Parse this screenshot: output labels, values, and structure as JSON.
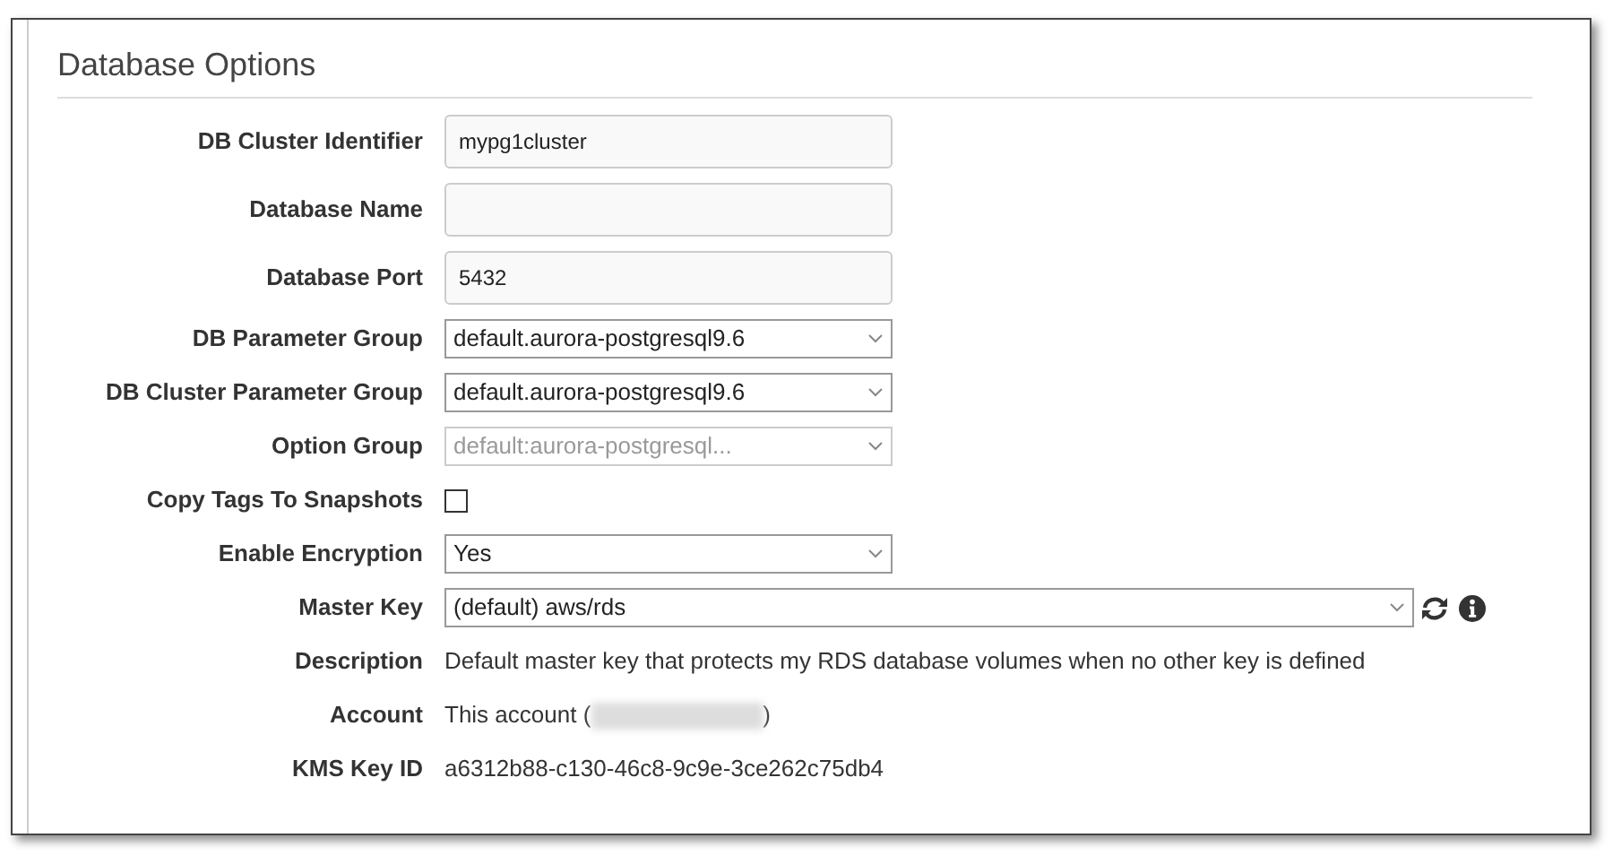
{
  "section": {
    "title": "Database Options"
  },
  "rows": [
    {
      "label": "DB Cluster Identifier",
      "kind": "text-input",
      "value": "mypg1cluster"
    },
    {
      "label": "Database Name",
      "kind": "text-input"
    },
    {
      "label": "Database Port",
      "kind": "text-input",
      "value": "5432"
    },
    {
      "label": "DB Parameter Group",
      "kind": "select",
      "value": "default.aurora-postgresql9.6",
      "disabled": false
    },
    {
      "label": "DB Cluster Parameter Group",
      "kind": "select",
      "value": "default.aurora-postgresql9.6",
      "disabled": false
    },
    {
      "label": "Option Group",
      "kind": "select",
      "value": "default:aurora-postgresql...",
      "disabled": true
    },
    {
      "label": "Copy Tags To Snapshots",
      "kind": "checkbox",
      "checked": false
    },
    {
      "label": "Enable Encryption",
      "kind": "select",
      "value": "Yes",
      "disabled": false
    },
    {
      "label": "Master Key",
      "kind": "key-select",
      "value": "(default) aws/rds"
    },
    {
      "label": "Description",
      "kind": "info",
      "value": "Default master key that protects my RDS database volumes when no other key is defined"
    },
    {
      "label": "Account",
      "kind": "info",
      "value": "This account (",
      "redacted": true,
      "value_end": ")"
    },
    {
      "label": "KMS Key ID",
      "kind": "info",
      "value": "a6312b88-c130-46c8-9c9e-3ce262c75db4"
    }
  ]
}
